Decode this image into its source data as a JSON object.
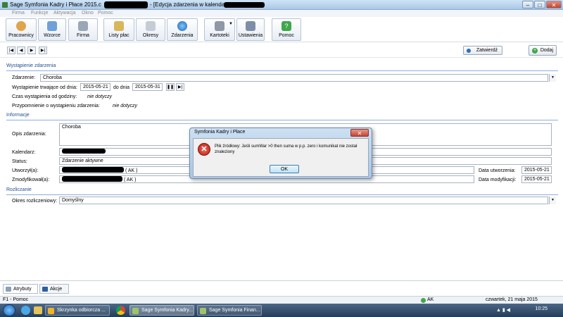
{
  "window": {
    "title": "Sage Symfonia Kadry i Płace 2015.c",
    "subtitle": "- [Edycja zdarzenia w kalendarzu",
    "controls": {
      "minimize": "–",
      "maximize": "□",
      "close": "✕"
    }
  },
  "menu": [
    "Firma",
    "Funkcje",
    "Aktywacja",
    "Okno",
    "Pomoc"
  ],
  "toolbar": [
    {
      "label": "Pracownicy",
      "icon": "user-icon"
    },
    {
      "label": "Wzorce",
      "icon": "template-icon"
    },
    {
      "label": "Firma",
      "icon": "building-icon"
    },
    {
      "label": "Listy płac",
      "icon": "payroll-icon"
    },
    {
      "label": "Okresy",
      "icon": "calendar-icon"
    },
    {
      "label": "Zdarzenia",
      "icon": "globe-icon"
    },
    {
      "label": "Kartoteki",
      "icon": "cards-icon"
    },
    {
      "label": "Ustawienia",
      "icon": "tools-icon"
    },
    {
      "label": "Pomoc",
      "icon": "help-icon"
    }
  ],
  "nav": {
    "first": "|◀",
    "prev": "◀",
    "next": "▶",
    "last": "▶|",
    "confirm_label": "Zatwierdź",
    "add_label": "Dodaj"
  },
  "sections": {
    "occurrence": "Wystąpienie zdarzenia",
    "info": "Informacje",
    "settlement": "Rozliczanie"
  },
  "occurrence": {
    "event_label": "Zdarzenie:",
    "event_value": "Choroba",
    "duration_label": "Wystąpienie trwające od dnia:",
    "date_from": "2015-05-21",
    "to_label": "do dnia",
    "date_to": "2015-05-31",
    "time_label": "Czas wystąpienia od godziny:",
    "time_value": "nie dotyczy",
    "reminder_label": "Przypomnienie o wystąpieniu zdarzenia:",
    "reminder_value": "nie dotyczy"
  },
  "info": {
    "desc_label": "Opis zdarzenia:",
    "desc_value": "Choroba",
    "calendar_label": "Kalendarz:",
    "status_label": "Status:",
    "status_value": "Zdarzenie aktywne",
    "created_by_label": "Utworzył(a):",
    "created_by_suffix": "( AK )",
    "modified_by_label": "Zmodyfikował(a):",
    "modified_by_suffix": "( AK )",
    "created_date_label": "Data utworzenia:",
    "created_date": "2015-05-21",
    "modified_date_label": "Data modyfikacji:",
    "modified_date": "2015-05-21"
  },
  "settlement": {
    "period_label": "Okres rozliczeniowy:",
    "period_value": "Domyślny"
  },
  "dialog": {
    "title": "Symfonia Kadry i Płace",
    "message": "Plik źródłowy: Jeśli sumWar >0 then suma w p.p. zero i komunikat nie został znaleziony",
    "ok_label": "OK",
    "close": "✕"
  },
  "tabs": [
    {
      "label": "Atrybuty"
    },
    {
      "label": "Akcje"
    }
  ],
  "status": {
    "help": "F1 - Pomoc",
    "user": "AK",
    "date": "czwartek, 21 maja 2015"
  },
  "taskbar": {
    "items": [
      "Skrzynka odbiorcza ...",
      "Sage Symfonia Kadry...",
      "Sage Symfonia Finan..."
    ],
    "clock": "10:25"
  }
}
